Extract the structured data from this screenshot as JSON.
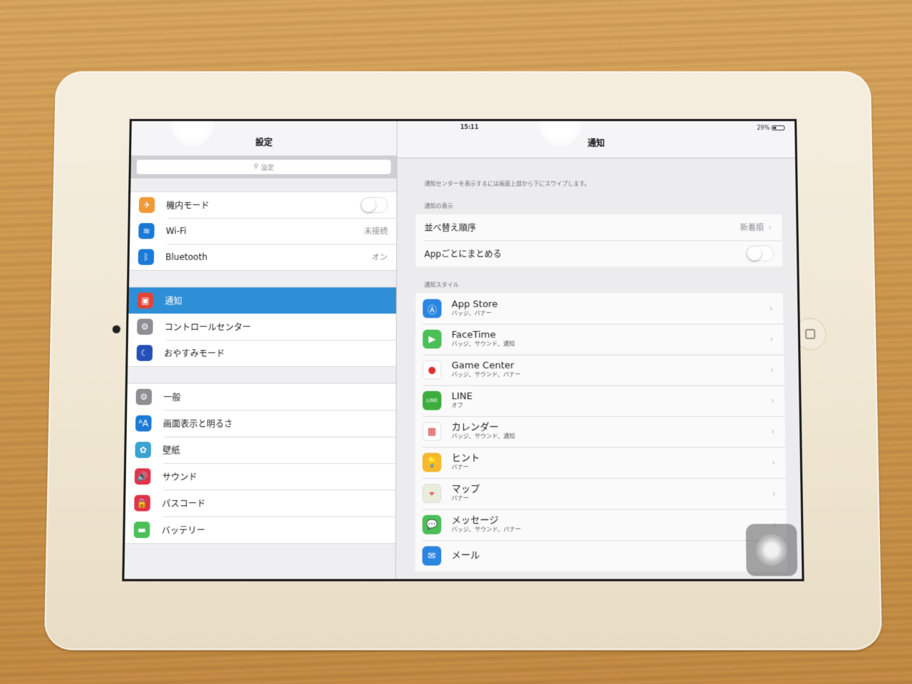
{
  "status_bar": {
    "time": "15:11",
    "battery_percent": "29%",
    "battery_level": 0.29
  },
  "left_pane": {
    "title": "設定",
    "search_placeholder": "設定",
    "groups": [
      [
        {
          "label": "機内モード",
          "icon": "airplane-icon",
          "color": "#f09a37",
          "glyph": "✈",
          "toggle": false
        },
        {
          "label": "Wi-Fi",
          "icon": "wifi-icon",
          "color": "#1b7ad6",
          "glyph": "≋",
          "value": "未接続"
        },
        {
          "label": "Bluetooth",
          "icon": "bluetooth-icon",
          "color": "#1b7ad6",
          "glyph": "ᛒ",
          "value": "オン"
        }
      ],
      [
        {
          "label": "通知",
          "icon": "notifications-icon",
          "color": "#e0453a",
          "glyph": "▣",
          "selected": true
        },
        {
          "label": "コントロールセンター",
          "icon": "control-center-icon",
          "color": "#8e8e93",
          "glyph": "⚙"
        },
        {
          "label": "おやすみモード",
          "icon": "do-not-disturb-icon",
          "color": "#2450b8",
          "glyph": "☾"
        }
      ],
      [
        {
          "label": "一般",
          "icon": "gear-icon",
          "color": "#8e8e93",
          "glyph": "⚙"
        },
        {
          "label": "画面表示と明るさ",
          "icon": "display-brightness-icon",
          "color": "#1b7ad6",
          "glyph": "ᴬA"
        },
        {
          "label": "壁紙",
          "icon": "wallpaper-icon",
          "color": "#3aa3d1",
          "glyph": "✿"
        },
        {
          "label": "サウンド",
          "icon": "sound-icon",
          "color": "#e0344a",
          "glyph": "🔊"
        },
        {
          "label": "パスコード",
          "icon": "lock-icon",
          "color": "#e0344a",
          "glyph": "🔒"
        },
        {
          "label": "バッテリー",
          "icon": "battery-icon",
          "color": "#4cbf58",
          "glyph": "▬"
        }
      ]
    ]
  },
  "right_pane": {
    "title": "通知",
    "hint": "通知センターを表示するには画面上部から下にスワイプします。",
    "display_section_title": "通知の表示",
    "sort_order_label": "並べ替え順序",
    "sort_order_value": "新着順",
    "group_by_app_label": "Appごとにまとめる",
    "group_by_app_on": false,
    "style_section_title": "通知スタイル",
    "apps": [
      {
        "name": "App Store",
        "sub": "バッジ、バナー",
        "icon": "app-store-icon",
        "color": "#2b86e0",
        "glyph": "Ⓐ"
      },
      {
        "name": "FaceTime",
        "sub": "バッジ、サウンド、通知",
        "icon": "facetime-icon",
        "color": "#4cbf58",
        "glyph": "▶"
      },
      {
        "name": "Game Center",
        "sub": "バッジ、サウンド、バナー",
        "icon": "game-center-icon",
        "color": "#ffffff",
        "glyph": "●"
      },
      {
        "name": "LINE",
        "sub": "オフ",
        "icon": "line-icon",
        "color": "#3dae3e",
        "glyph": "LINE"
      },
      {
        "name": "カレンダー",
        "sub": "バッジ、サウンド、通知",
        "icon": "calendar-icon",
        "color": "#ffffff",
        "glyph": "▦"
      },
      {
        "name": "ヒント",
        "sub": "バナー",
        "icon": "tips-icon",
        "color": "#f5b82e",
        "glyph": "💡"
      },
      {
        "name": "マップ",
        "sub": "バナー",
        "icon": "maps-icon",
        "color": "#e9eddc",
        "glyph": "⌖"
      },
      {
        "name": "メッセージ",
        "sub": "バッジ、サウンド、バナー",
        "icon": "messages-icon",
        "color": "#4cbf58",
        "glyph": "💬"
      },
      {
        "name": "メール",
        "sub": "",
        "icon": "mail-icon",
        "color": "#2b86e0",
        "glyph": "✉"
      }
    ]
  }
}
